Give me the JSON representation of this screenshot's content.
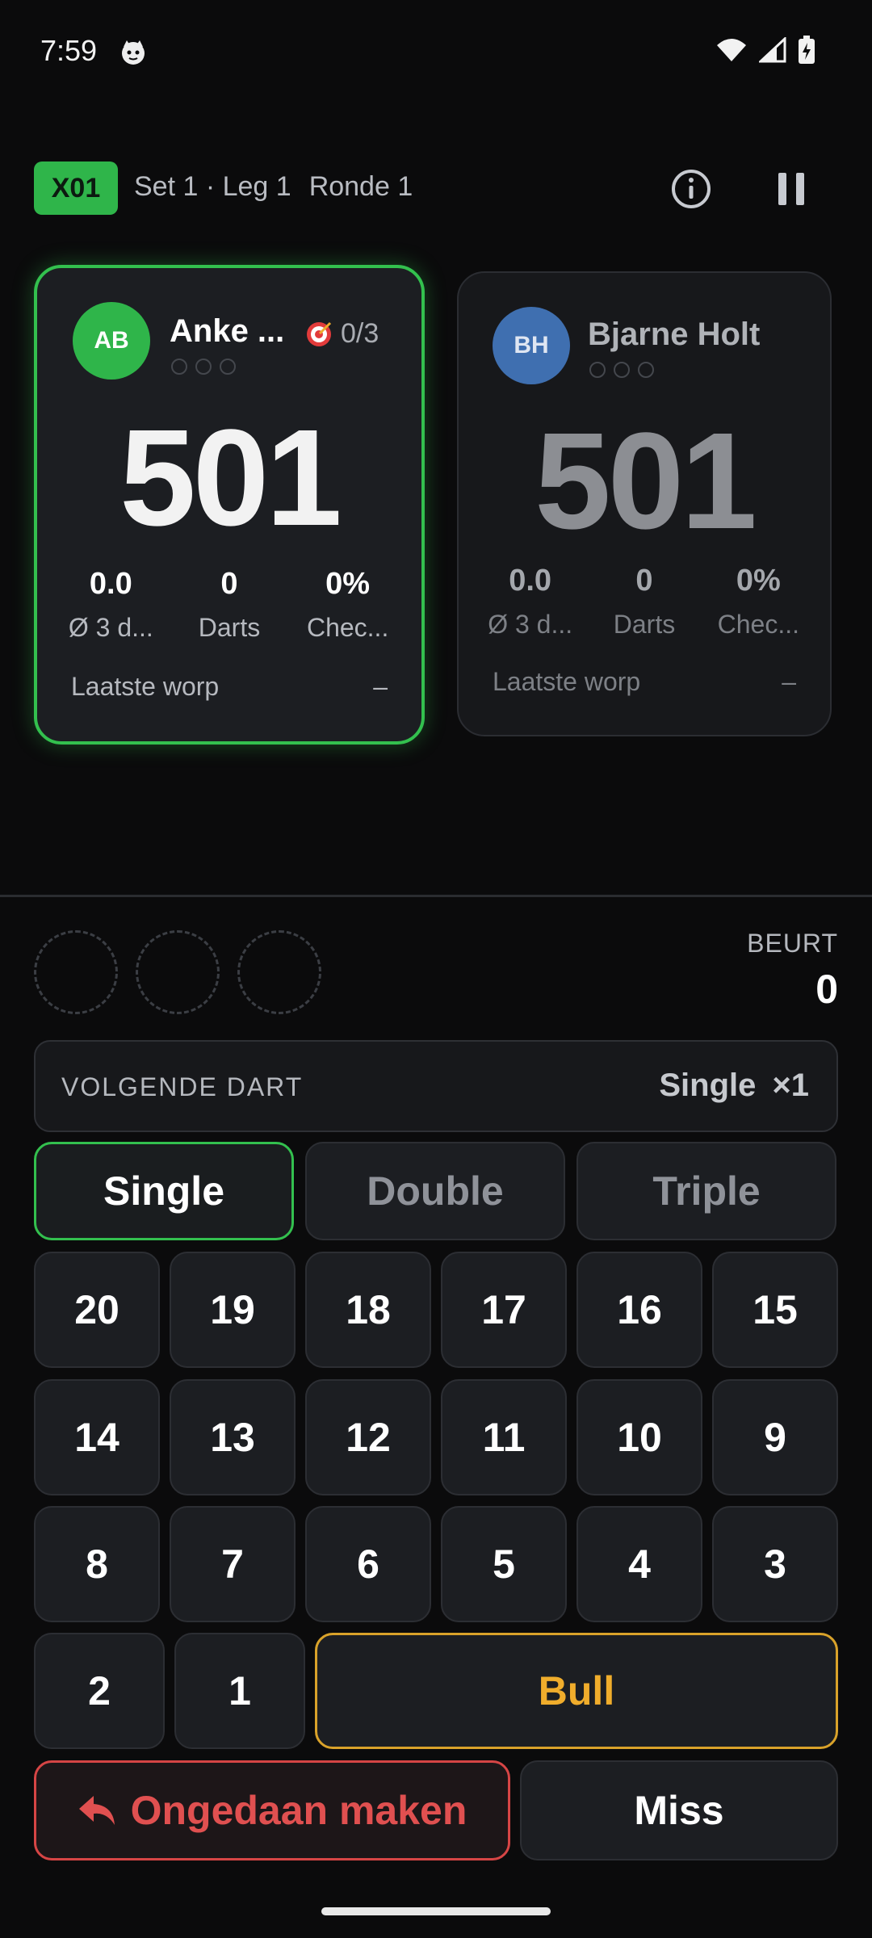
{
  "status_bar": {
    "time": "7:59",
    "icons": [
      "cat-icon",
      "wifi-icon",
      "signal-icon",
      "battery-charging-icon"
    ]
  },
  "header": {
    "mode": "X01",
    "set_leg": "Set 1 · Leg 1",
    "round": "Ronde 1",
    "icons": [
      "info-icon",
      "pause-icon"
    ]
  },
  "players": [
    {
      "initials": "AB",
      "name": "Anke ...",
      "checkout": "0/3",
      "score": "501",
      "stats": [
        {
          "value": "0.0",
          "label": "Ø 3 d..."
        },
        {
          "value": "0",
          "label": "Darts"
        },
        {
          "value": "0%",
          "label": "Chec..."
        }
      ],
      "last_throw_label": "Laatste worp",
      "last_throw_value": "–",
      "active": true
    },
    {
      "initials": "BH",
      "name": "Bjarne Holt",
      "score": "501",
      "stats": [
        {
          "value": "0.0",
          "label": "Ø 3 d..."
        },
        {
          "value": "0",
          "label": "Darts"
        },
        {
          "value": "0%",
          "label": "Chec..."
        }
      ],
      "last_throw_label": "Laatste worp",
      "last_throw_value": "–",
      "active": false
    }
  ],
  "turn": {
    "label": "BEURT",
    "value": "0"
  },
  "next_dart": {
    "label": "VOLGENDE DART",
    "mode": "Single",
    "multiplier": "×1"
  },
  "multipliers": [
    "Single",
    "Double",
    "Triple"
  ],
  "numbers": [
    "20",
    "19",
    "18",
    "17",
    "16",
    "15",
    "14",
    "13",
    "12",
    "11",
    "10",
    "9",
    "8",
    "7",
    "6",
    "5",
    "4",
    "3",
    "2",
    "1"
  ],
  "bull": "Bull",
  "undo": "Ongedaan maken",
  "miss": "Miss",
  "colors": {
    "accent_green": "#33c04e",
    "bull_orange": "#f0ad2c",
    "undo_red": "#e05050",
    "avatar_blue": "#3f6fb0"
  }
}
